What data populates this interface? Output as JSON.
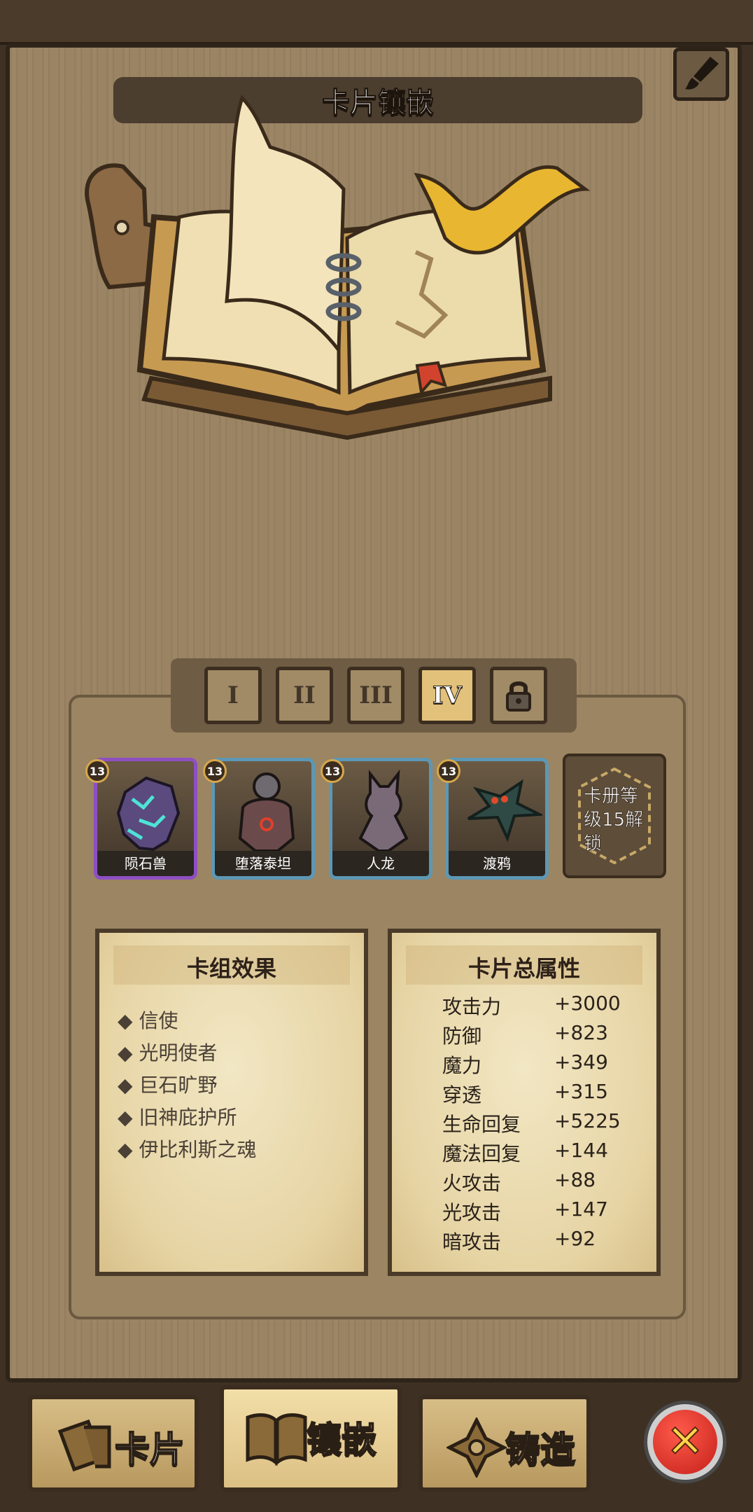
{
  "header": {
    "title": "卡片镶嵌"
  },
  "tiers": {
    "tabs": [
      "I",
      "II",
      "III",
      "IV"
    ],
    "active_index": 3,
    "locked_icon": "lock-icon"
  },
  "cards": [
    {
      "name": "陨石兽",
      "level": "13",
      "rarity": "purple"
    },
    {
      "name": "堕落泰坦",
      "level": "13",
      "rarity": "blue"
    },
    {
      "name": "人龙",
      "level": "13",
      "rarity": "blue"
    },
    {
      "name": "渡鸦",
      "level": "13",
      "rarity": "blue"
    }
  ],
  "locked_slot": {
    "text": "卡册等级15解锁"
  },
  "deck_effects": {
    "title": "卡组效果",
    "items": [
      "信使",
      "光明使者",
      "巨石旷野",
      "旧神庇护所",
      "伊比利斯之魂"
    ]
  },
  "card_stats": {
    "title": "卡片总属性",
    "rows": [
      {
        "name": "攻击力",
        "value": "+3000"
      },
      {
        "name": "防御",
        "value": "+823"
      },
      {
        "name": "魔力",
        "value": "+349"
      },
      {
        "name": "穿透",
        "value": "+315"
      },
      {
        "name": "生命回复",
        "value": "+5225"
      },
      {
        "name": "魔法回复",
        "value": "+144"
      },
      {
        "name": "火攻击",
        "value": "+88"
      },
      {
        "name": "光攻击",
        "value": "+147"
      },
      {
        "name": "暗攻击",
        "value": "+92"
      }
    ]
  },
  "bottom_nav": {
    "cards": "卡片",
    "inlay": "镶嵌",
    "forge": "铸造"
  },
  "colors": {
    "accent_gold": "#e2c27a",
    "close_red": "#d42a1e",
    "rarity_purple": "#8e4fc3",
    "rarity_blue": "#5d97b4"
  }
}
